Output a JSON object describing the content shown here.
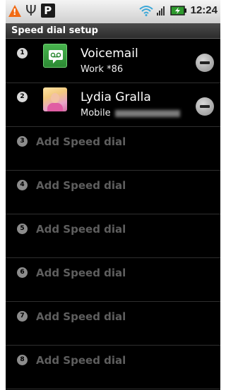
{
  "status_bar": {
    "clock": "12:24",
    "icons": [
      "warning-icon",
      "usb-icon",
      "p-notification-icon",
      "wifi-icon",
      "signal-icon",
      "battery-charging-icon"
    ],
    "warning_glyph": "!",
    "usb_glyph": "Ψ",
    "p_glyph": "P"
  },
  "title_bar": {
    "title": "Speed dial setup"
  },
  "entries": [
    {
      "number": "1",
      "name": "Voicemail",
      "type": "Work",
      "value": "*86",
      "icon": "voicemail-icon"
    },
    {
      "number": "2",
      "name": "Lydia Gralla",
      "type": "Mobile",
      "value": "",
      "icon": "contact-photo"
    },
    {
      "number": "3",
      "label": "Add Speed dial"
    },
    {
      "number": "4",
      "label": "Add Speed dial"
    },
    {
      "number": "5",
      "label": "Add Speed dial"
    },
    {
      "number": "6",
      "label": "Add Speed dial"
    },
    {
      "number": "7",
      "label": "Add Speed dial"
    },
    {
      "number": "8",
      "label": "Add Speed dial"
    }
  ],
  "colors": {
    "background": "#000000",
    "voicemail_green": "#3da544",
    "status_bar": "#dcdcdc",
    "warning": "#f16a14"
  }
}
